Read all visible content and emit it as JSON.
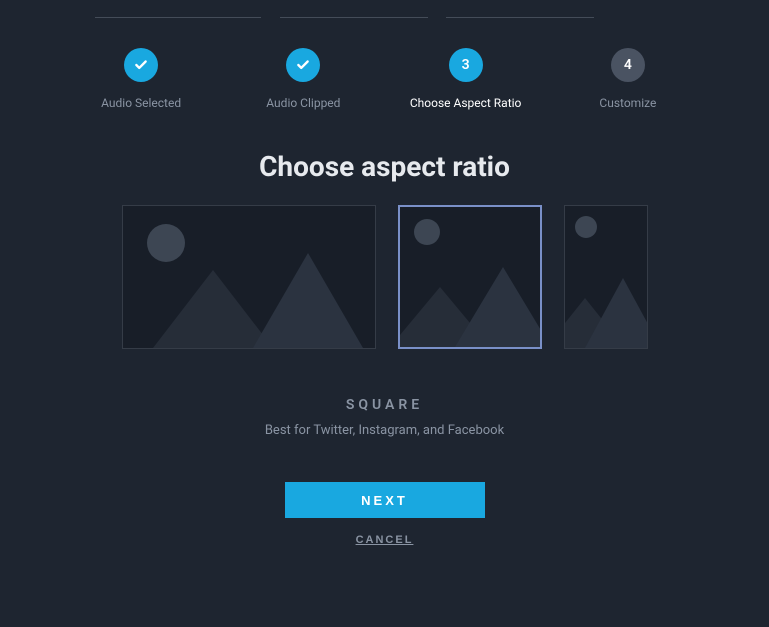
{
  "stepper": {
    "steps": [
      {
        "label": "Audio Selected",
        "state": "done"
      },
      {
        "label": "Audio Clipped",
        "state": "done"
      },
      {
        "label": "Choose Aspect Ratio",
        "state": "current",
        "number": "3"
      },
      {
        "label": "Customize",
        "state": "future",
        "number": "4"
      }
    ]
  },
  "page": {
    "title": "Choose aspect ratio",
    "selected_option_name": "SQUARE",
    "selected_option_desc": "Best for Twitter, Instagram, and Facebook"
  },
  "options": [
    {
      "id": "landscape",
      "selected": false
    },
    {
      "id": "square",
      "selected": true
    },
    {
      "id": "portrait",
      "selected": false
    }
  ],
  "actions": {
    "next": "NEXT",
    "cancel": "CANCEL"
  }
}
